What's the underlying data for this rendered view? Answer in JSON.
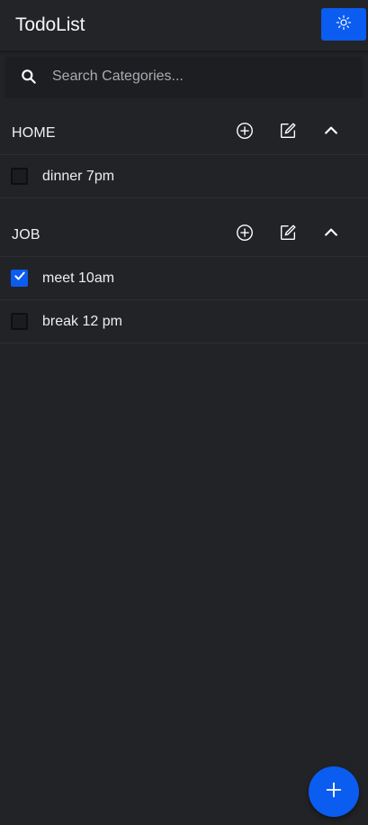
{
  "app": {
    "title": "TodoList",
    "accent_color": "#0b5cf0",
    "theme_toggle_icon": "sun-icon"
  },
  "search": {
    "placeholder": "Search Categories...",
    "value": "",
    "icon": "search-icon"
  },
  "categories": [
    {
      "name": "HOME",
      "actions": [
        "add-circle-icon",
        "edit-icon",
        "chevron-up-icon"
      ],
      "todos": [
        {
          "label": "dinner 7pm",
          "checked": false
        }
      ]
    },
    {
      "name": "JOB",
      "actions": [
        "add-circle-icon",
        "edit-icon",
        "chevron-up-icon"
      ],
      "todos": [
        {
          "label": "meet 10am",
          "checked": true
        },
        {
          "label": "break 12 pm",
          "checked": false
        }
      ]
    }
  ],
  "fab": {
    "icon": "plus-icon"
  }
}
